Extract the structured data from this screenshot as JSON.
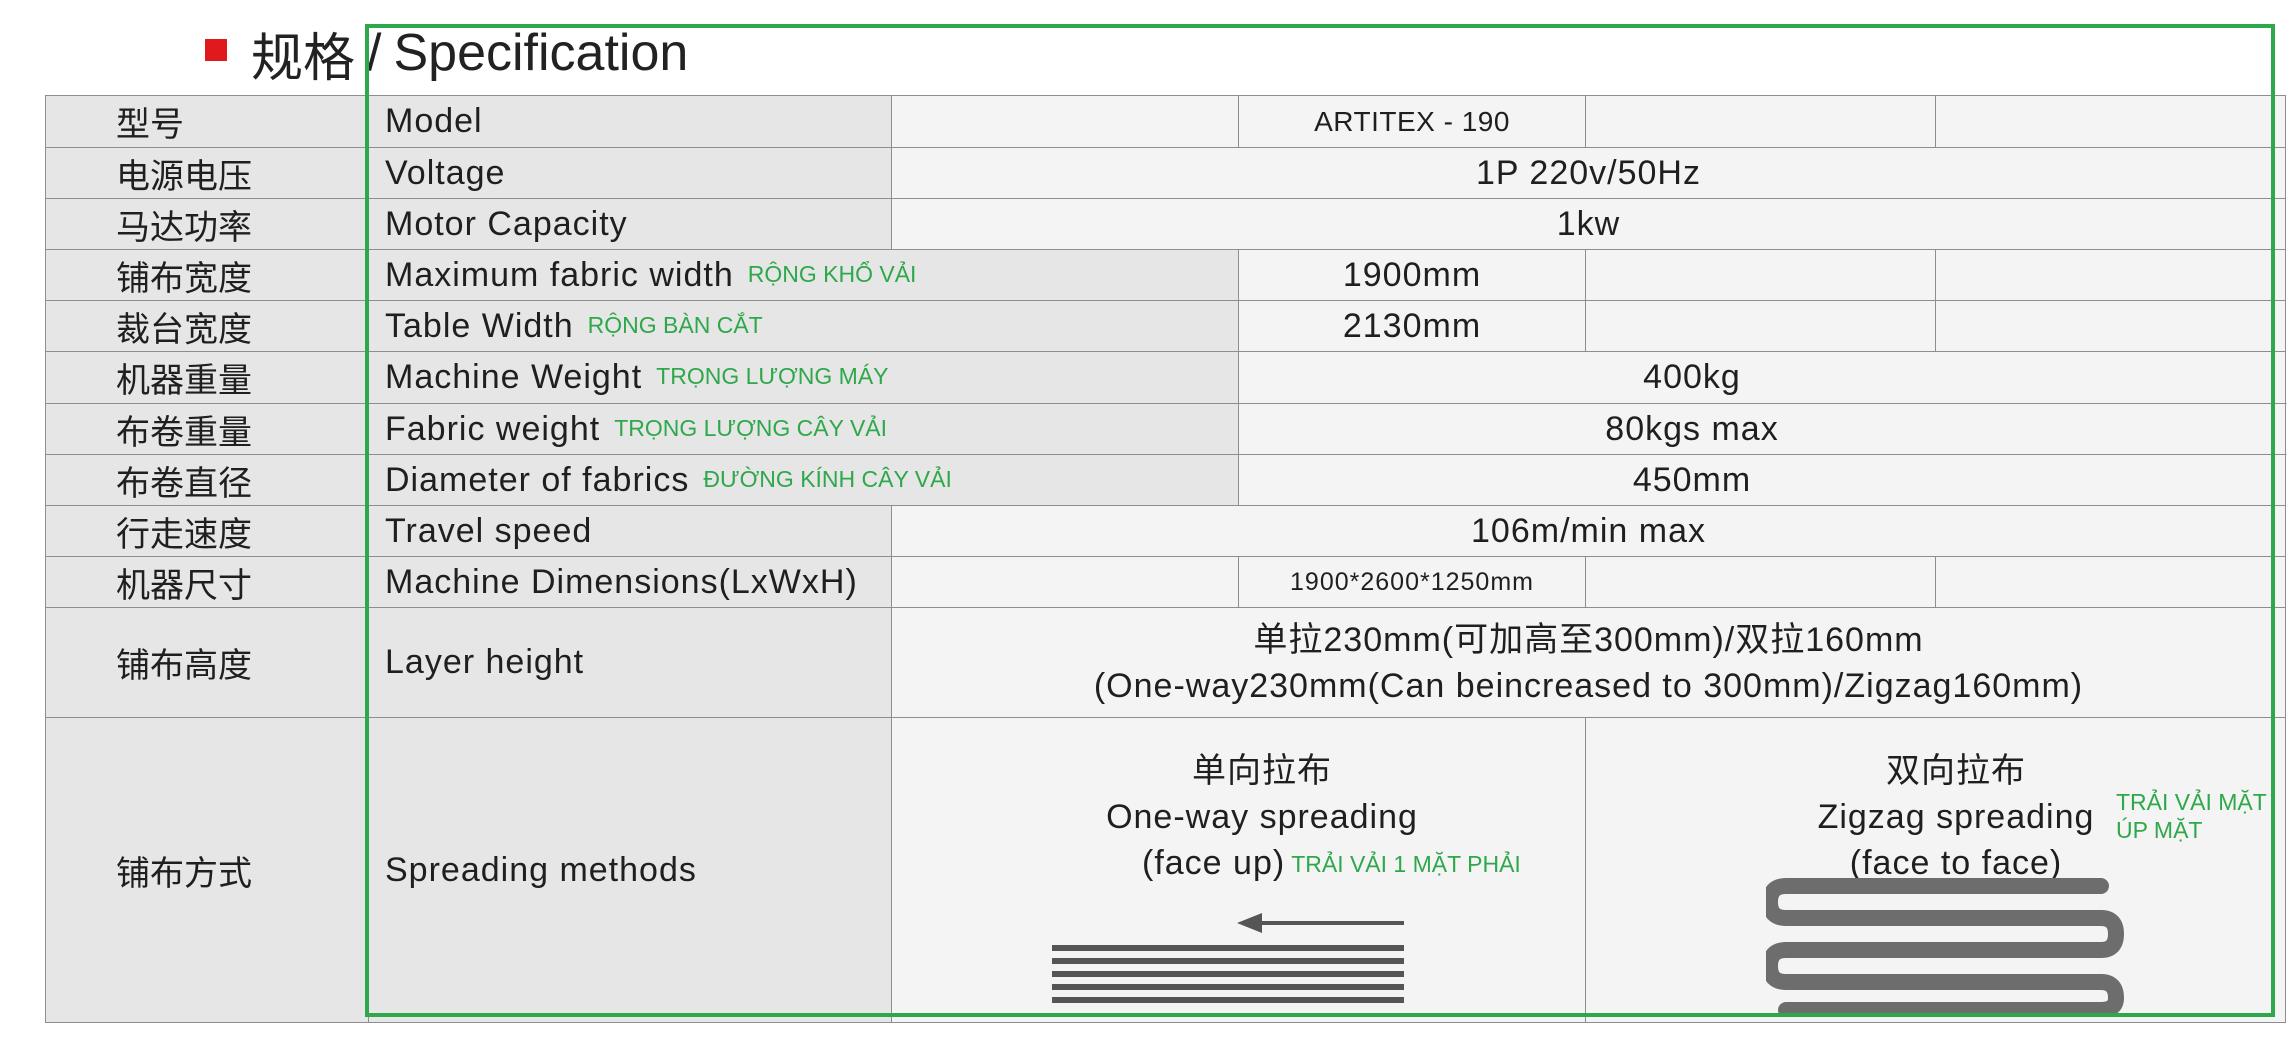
{
  "heading": {
    "zh": "规格",
    "sep": "/",
    "en": "Specification"
  },
  "rows": [
    {
      "zh": "型号",
      "en": "Model",
      "vn": "",
      "value": "ARTITEX - 190"
    },
    {
      "zh": "电源电压",
      "en": "Voltage",
      "vn": "",
      "value": "1P 220v/50Hz"
    },
    {
      "zh": "马达功率",
      "en": "Motor Capacity",
      "vn": "",
      "value": "1kw"
    },
    {
      "zh": "铺布宽度",
      "en": "Maximum fabric width",
      "vn": "RỘNG KHỔ VẢI",
      "value": "1900mm"
    },
    {
      "zh": "裁台宽度",
      "en": "Table Width",
      "vn": "RỘNG BÀN CẮT",
      "value": "2130mm"
    },
    {
      "zh": "机器重量",
      "en": "Machine Weight",
      "vn": "TRỌNG LƯỢNG MÁY",
      "value": "400kg"
    },
    {
      "zh": "布卷重量",
      "en": "Fabric weight",
      "vn": "TRỌNG LƯỢNG CÂY VẢI",
      "value": "80kgs max"
    },
    {
      "zh": "布卷直径",
      "en": "Diameter of fabrics",
      "vn": "ĐƯỜNG KÍNH CÂY VẢI",
      "value": "450mm"
    },
    {
      "zh": "行走速度",
      "en": "Travel speed",
      "vn": "",
      "value": "106m/min max"
    },
    {
      "zh": "机器尺寸",
      "en": "Machine Dimensions(LxWxH)",
      "vn": "",
      "value": "1900*2600*1250mm"
    }
  ],
  "layer": {
    "zh": "铺布高度",
    "en": "Layer height",
    "line1": "单拉230mm(可加高至300mm)/双拉160mm",
    "line2": "(One-way230mm(Can beincreased to 300mm)/Zigzag160mm)"
  },
  "methods": {
    "zh": "铺布方式",
    "en": "Spreading methods",
    "oneway": {
      "zh": "单向拉布",
      "en": "One-way spreading",
      "face": "(face up)",
      "vn": "TRẢI VẢI 1 MẶT PHẢI"
    },
    "zigzag": {
      "zh": "双向拉布",
      "en": "Zigzag spreading",
      "face": "(face to face)",
      "vn1": "TRẢI VẢI MẶT",
      "vn2": "ÚP MẶT"
    }
  },
  "colors": {
    "accent_red": "#e0191d",
    "annotation_green": "#2ea84a",
    "label_bg": "#e6e6e6",
    "value_bg": "#f4f4f4"
  }
}
